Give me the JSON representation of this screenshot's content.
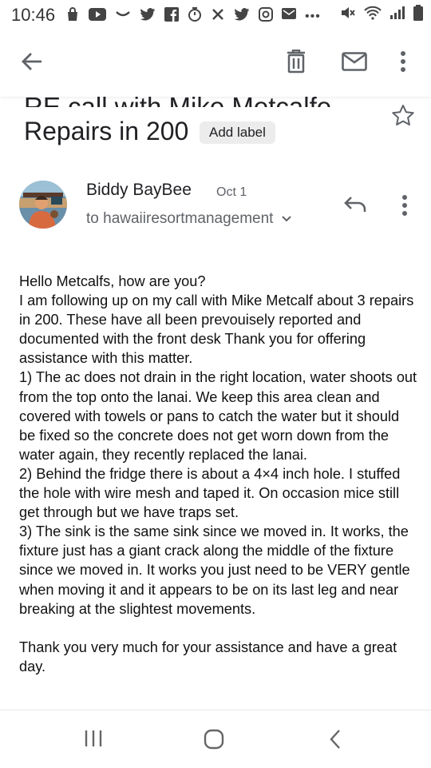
{
  "status_bar": {
    "time": "10:46",
    "ellipsis": "•••"
  },
  "toolbar": {
    "back_icon": "arrow-left-icon",
    "delete_icon": "trash-icon",
    "mail_icon": "mail-icon",
    "more_icon": "more-vert-icon"
  },
  "email": {
    "subject_line1": "RE call with Mike Metcalfe,",
    "subject_line2": "Repairs in 200",
    "add_label": "Add label",
    "sender_name": "Biddy BayBee",
    "date": "Oct 1",
    "recipient": "to hawaiiresortmanagement",
    "body": "Hello Metcalfs, how are you?\nI am following up on my call with Mike Metcalf about 3 repairs in 200. These have all been prevouisely reported and documented with the front desk Thank you for offering assistance with this matter.\n1) The ac does not drain in the right location, water shoots out from the top onto the lanai. We keep this area clean and covered with towels or pans to catch the water but it should be fixed so the concrete does not get worn down from the water again, they recently replaced the lanai.\n2) Behind the fridge there is about a 4×4 inch hole. I stuffed the hole with wire mesh and taped it. On occasion mice still get through but we have traps set.\n3) The sink is the same sink since we moved in. It works, the fixture just has a giant crack along the middle of the fixture since we moved in. It works you just need to be VERY gentle when moving it and it appears to be on its last leg and near breaking at the slightest movements.\n\nThank you very much for your assistance and have a great day."
  },
  "colors": {
    "text": "#202124",
    "secondary": "#5f6368",
    "icon": "#5f6368",
    "chip_bg": "#ececec"
  }
}
